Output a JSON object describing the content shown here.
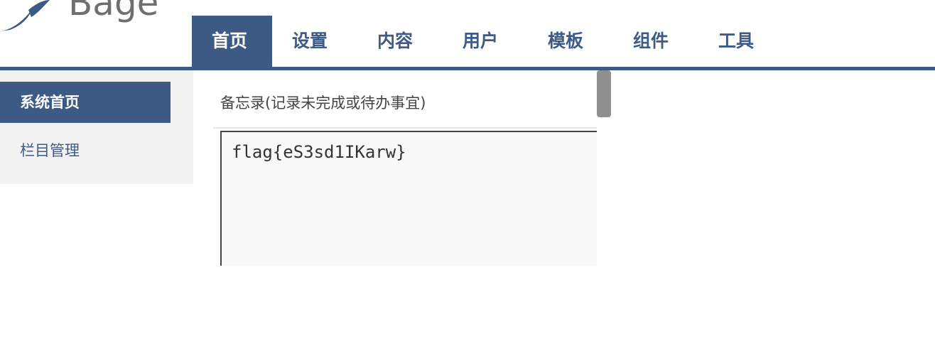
{
  "brand": {
    "name": "Bage"
  },
  "topnav": {
    "items": [
      {
        "label": "首页",
        "active": true
      },
      {
        "label": "设置",
        "active": false
      },
      {
        "label": "内容",
        "active": false
      },
      {
        "label": "用户",
        "active": false
      },
      {
        "label": "模板",
        "active": false
      },
      {
        "label": "组件",
        "active": false
      },
      {
        "label": "工具",
        "active": false
      }
    ]
  },
  "sidebar": {
    "items": [
      {
        "label": "系统首页",
        "active": true
      },
      {
        "label": "栏目管理",
        "active": false
      }
    ]
  },
  "main": {
    "title": "备忘录(记录未完成或待办事宜)",
    "memo_value": "flag{eS3sd1IKarw}"
  },
  "colors": {
    "accent": "#3d5a84",
    "nav_text": "#3e5a86",
    "sidebar_bg": "#f2f2f2"
  }
}
